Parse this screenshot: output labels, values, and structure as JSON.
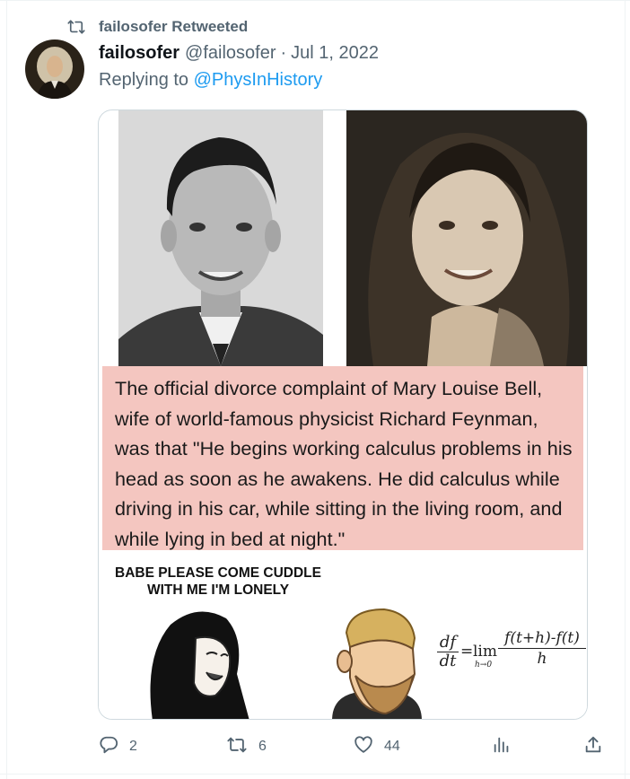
{
  "retweet_banner": {
    "icon": "retweet-icon",
    "text": "failosofer Retweeted"
  },
  "tweet": {
    "author_name": "failosofer",
    "author_handle": "@failosofer",
    "separator": "·",
    "date": "Jul 1, 2022",
    "reply_prefix": "Replying to",
    "reply_mention": "@PhysInHistory"
  },
  "media": {
    "caption": "The official divorce complaint of Mary Louise Bell, wife of world-famous physicist Richard Feynman, was that \"He begins working calculus problems in his head as soon as he awakens. He did calculus while driving in his car, while sitting in the living room, and while lying in bed at night.\"",
    "meme_title_line1": "BABE PLEASE COME CUDDLE",
    "meme_title_line2": "WITH ME I'M LONELY",
    "formula": {
      "lhs_num": "df",
      "lhs_den": "dt",
      "eq": "=",
      "lim": "lim",
      "lim_sub": "h→0",
      "rhs_num": "f(t+h)-f(t)",
      "rhs_den": "h"
    }
  },
  "actions": {
    "reply": {
      "icon": "reply-icon",
      "count": "2"
    },
    "retweet": {
      "icon": "retweet-icon",
      "count": "6"
    },
    "like": {
      "icon": "heart-icon",
      "count": "44"
    },
    "views": {
      "icon": "bar-chart-icon"
    },
    "share": {
      "icon": "share-icon"
    }
  },
  "colors": {
    "secondary_text": "#536471",
    "link": "#1d9bf0",
    "caption_bg": "#f4c6c0",
    "border": "#cfd9de"
  }
}
